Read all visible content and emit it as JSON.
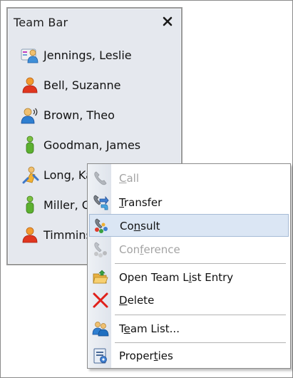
{
  "team_bar": {
    "title": "Team Bar",
    "close_icon": "close-icon",
    "members": [
      {
        "name": "Jennings, Leslie",
        "icon": "vcard-person-icon"
      },
      {
        "name": "Bell, Suzanne",
        "icon": "person-busy-icon"
      },
      {
        "name": "Brown, Theo",
        "icon": "person-on-call-icon"
      },
      {
        "name": "Goodman, James",
        "icon": "person-available-icon"
      },
      {
        "name": "Long, Karen",
        "icon": "person-away-icon"
      },
      {
        "name": "Miller, Chris",
        "icon": "person-available-icon"
      },
      {
        "name": "Timmins, Sarah",
        "icon": "person-busy-icon"
      }
    ]
  },
  "context_menu": {
    "items": [
      {
        "pre": "",
        "u": "C",
        "post": "all",
        "icon": "phone-icon",
        "enabled": false
      },
      {
        "pre": "",
        "u": "T",
        "post": "ransfer",
        "icon": "transfer-icon",
        "enabled": true
      },
      {
        "pre": "Co",
        "u": "n",
        "post": "sult",
        "icon": "consult-icon",
        "enabled": true,
        "highlighted": true
      },
      {
        "pre": "Con",
        "u": "f",
        "post": "erence",
        "icon": "conference-icon",
        "enabled": false
      },
      {
        "pre": "Open Team L",
        "u": "i",
        "post": "st Entry",
        "icon": "open-folder-icon",
        "enabled": true
      },
      {
        "pre": "",
        "u": "D",
        "post": "elete",
        "icon": "delete-icon",
        "enabled": true
      },
      {
        "pre": "T",
        "u": "e",
        "post": "am List...",
        "icon": "team-list-icon",
        "enabled": true
      },
      {
        "pre": "Proper",
        "u": "t",
        "post": "ies",
        "icon": "properties-icon",
        "enabled": true
      }
    ]
  },
  "colors": {
    "panel_bg": "#e5e8ee",
    "highlight_bg": "#dbe6f4",
    "disabled_text": "#a3a3a3"
  }
}
